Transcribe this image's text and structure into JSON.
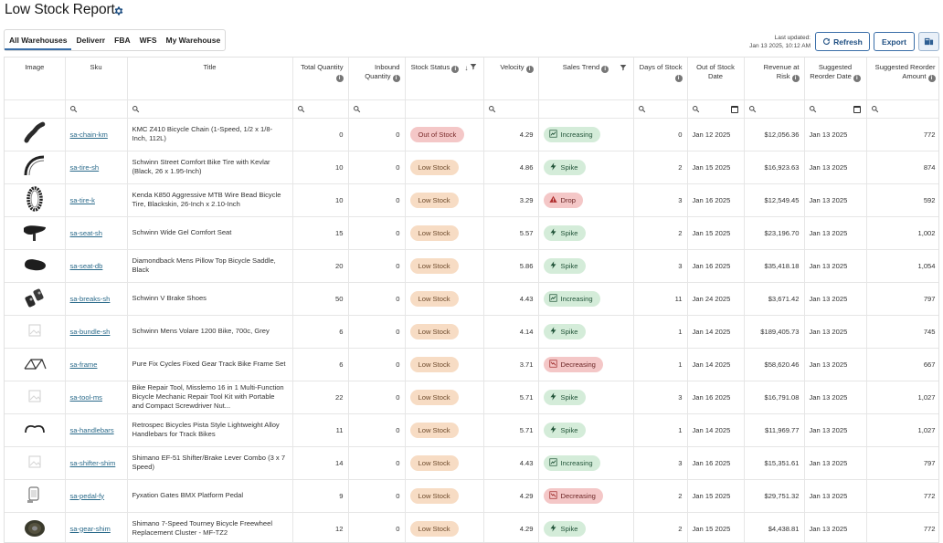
{
  "page": {
    "title": "Low Stock Report"
  },
  "tabs": [
    {
      "label": "All Warehouses",
      "active": true
    },
    {
      "label": "Deliverr"
    },
    {
      "label": "FBA"
    },
    {
      "label": "WFS"
    },
    {
      "label": "My Warehouse"
    }
  ],
  "toolbar": {
    "updated_label": "Last updated:",
    "updated_value": "Jan 13 2025, 10:12 AM",
    "refresh_label": "Refresh",
    "export_label": "Export"
  },
  "columns": {
    "image": "Image",
    "sku": "Sku",
    "title": "Title",
    "total_qty": "Total Quantity",
    "inbound_qty": "Inbound Quantity",
    "stock_status": "Stock Status",
    "velocity": "Velocity",
    "sales_trend": "Sales Trend",
    "days_of_stock": "Days of Stock",
    "out_of_stock_date": "Out of Stock Date",
    "revenue_at_risk": "Revenue at Risk",
    "suggested_reorder_date": "Suggested Reorder Date",
    "suggested_reorder_amount": "Suggested Reorder Amount"
  },
  "rows": [
    {
      "icon": "bicycle-chain-icon",
      "sku": "sa-chain-km",
      "title": "KMC Z410 Bicycle Chain (1-Speed, 1/2 x 1/8-Inch, 112L)",
      "total": "0",
      "inbound": "0",
      "status": "Out of Stock",
      "status_type": "out",
      "velocity": "4.29",
      "trend": "Increasing",
      "trend_type": "inc",
      "days": "0",
      "oos_date": "Jan 12 2025",
      "revenue": "$12,056.36",
      "reorder_date": "Jan 13 2025",
      "reorder_amount": "772"
    },
    {
      "icon": "bike-tire-icon",
      "sku": "sa-tire-sh",
      "title": "Schwinn Street Comfort Bike Tire with Kevlar (Black, 26 x 1.95-Inch)",
      "total": "10",
      "inbound": "0",
      "status": "Low Stock",
      "status_type": "low",
      "velocity": "4.86",
      "trend": "Spike",
      "trend_type": "spike",
      "days": "2",
      "oos_date": "Jan 15 2025",
      "revenue": "$16,923.63",
      "reorder_date": "Jan 13 2025",
      "reorder_amount": "874"
    },
    {
      "icon": "mtb-tire-icon",
      "sku": "sa-tire-k",
      "title": "Kenda K850 Aggressive MTB Wire Bead Bicycle Tire, Blackskin, 26-Inch x 2.10-Inch",
      "total": "10",
      "inbound": "0",
      "status": "Low Stock",
      "status_type": "low",
      "velocity": "3.29",
      "trend": "Drop",
      "trend_type": "drop",
      "days": "3",
      "oos_date": "Jan 16 2025",
      "revenue": "$12,549.45",
      "reorder_date": "Jan 13 2025",
      "reorder_amount": "592"
    },
    {
      "icon": "bike-seat-icon",
      "sku": "sa-seat-sh",
      "title": "Schwinn Wide Gel Comfort Seat",
      "total": "15",
      "inbound": "0",
      "status": "Low Stock",
      "status_type": "low",
      "velocity": "5.57",
      "trend": "Spike",
      "trend_type": "spike",
      "days": "2",
      "oos_date": "Jan 15 2025",
      "revenue": "$23,196.70",
      "reorder_date": "Jan 13 2025",
      "reorder_amount": "1,002"
    },
    {
      "icon": "bike-saddle-icon",
      "sku": "sa-seat-db",
      "title": "Diamondback Mens Pillow Top Bicycle Saddle, Black",
      "total": "20",
      "inbound": "0",
      "status": "Low Stock",
      "status_type": "low",
      "velocity": "5.86",
      "trend": "Spike",
      "trend_type": "spike",
      "days": "3",
      "oos_date": "Jan 16 2025",
      "revenue": "$35,418.18",
      "reorder_date": "Jan 13 2025",
      "reorder_amount": "1,054"
    },
    {
      "icon": "brake-shoes-icon",
      "sku": "sa-breaks-sh",
      "title": "Schwinn V Brake Shoes",
      "total": "50",
      "inbound": "0",
      "status": "Low Stock",
      "status_type": "low",
      "velocity": "4.43",
      "trend": "Increasing",
      "trend_type": "inc",
      "days": "11",
      "oos_date": "Jan 24 2025",
      "revenue": "$3,671.42",
      "reorder_date": "Jan 13 2025",
      "reorder_amount": "797"
    },
    {
      "icon": "image-placeholder-icon",
      "sku": "sa-bundle-sh",
      "title": "Schwinn Mens Volare 1200 Bike, 700c, Grey",
      "total": "6",
      "inbound": "0",
      "status": "Low Stock",
      "status_type": "low",
      "velocity": "4.14",
      "trend": "Spike",
      "trend_type": "spike",
      "days": "1",
      "oos_date": "Jan 14 2025",
      "revenue": "$189,405.73",
      "reorder_date": "Jan 13 2025",
      "reorder_amount": "745"
    },
    {
      "icon": "bike-frame-icon",
      "sku": "sa-frame",
      "title": "Pure Fix Cycles Fixed Gear Track Bike Frame Set",
      "total": "6",
      "inbound": "0",
      "status": "Low Stock",
      "status_type": "low",
      "velocity": "3.71",
      "trend": "Decreasing",
      "trend_type": "dec",
      "days": "1",
      "oos_date": "Jan 14 2025",
      "revenue": "$58,620.46",
      "reorder_date": "Jan 13 2025",
      "reorder_amount": "667"
    },
    {
      "icon": "image-placeholder-icon",
      "sku": "sa-tool-ms",
      "title": "Bike Repair Tool, Misslemo 16 in 1 Multi-Function Bicycle Mechanic Repair Tool Kit with Portable and Compact Screwdriver Nut...",
      "total": "22",
      "inbound": "0",
      "status": "Low Stock",
      "status_type": "low",
      "velocity": "5.71",
      "trend": "Spike",
      "trend_type": "spike",
      "days": "3",
      "oos_date": "Jan 16 2025",
      "revenue": "$16,791.08",
      "reorder_date": "Jan 13 2025",
      "reorder_amount": "1,027"
    },
    {
      "icon": "handlebars-icon",
      "sku": "sa-handlebars",
      "title": "Retrospec Bicycles Pista Style Lightweight Alloy Handlebars for Track Bikes",
      "total": "11",
      "inbound": "0",
      "status": "Low Stock",
      "status_type": "low",
      "velocity": "5.71",
      "trend": "Spike",
      "trend_type": "spike",
      "days": "1",
      "oos_date": "Jan 14 2025",
      "revenue": "$11,969.77",
      "reorder_date": "Jan 13 2025",
      "reorder_amount": "1,027"
    },
    {
      "icon": "image-placeholder-icon",
      "sku": "sa-shifter-shim",
      "title": "Shimano EF-51 Shifter/Brake Lever Combo (3 x 7 Speed)",
      "total": "14",
      "inbound": "0",
      "status": "Low Stock",
      "status_type": "low",
      "velocity": "4.43",
      "trend": "Increasing",
      "trend_type": "inc",
      "days": "3",
      "oos_date": "Jan 16 2025",
      "revenue": "$15,351.61",
      "reorder_date": "Jan 13 2025",
      "reorder_amount": "797"
    },
    {
      "icon": "pedal-icon",
      "sku": "sa-pedal-fy",
      "title": "Fyxation Gates BMX Platform Pedal",
      "total": "9",
      "inbound": "0",
      "status": "Low Stock",
      "status_type": "low",
      "velocity": "4.29",
      "trend": "Decreasing",
      "trend_type": "dec",
      "days": "2",
      "oos_date": "Jan 15 2025",
      "revenue": "$29,751.32",
      "reorder_date": "Jan 13 2025",
      "reorder_amount": "772"
    },
    {
      "icon": "freewheel-cluster-icon",
      "sku": "sa-gear-shim",
      "title": "Shimano 7-Speed Tourney Bicycle Freewheel Replacement Cluster - MF-TZ2",
      "total": "12",
      "inbound": "0",
      "status": "Low Stock",
      "status_type": "low",
      "velocity": "4.29",
      "trend": "Spike",
      "trend_type": "spike",
      "days": "2",
      "oos_date": "Jan 15 2025",
      "revenue": "$4,438.81",
      "reorder_date": "Jan 13 2025",
      "reorder_amount": "772"
    }
  ]
}
